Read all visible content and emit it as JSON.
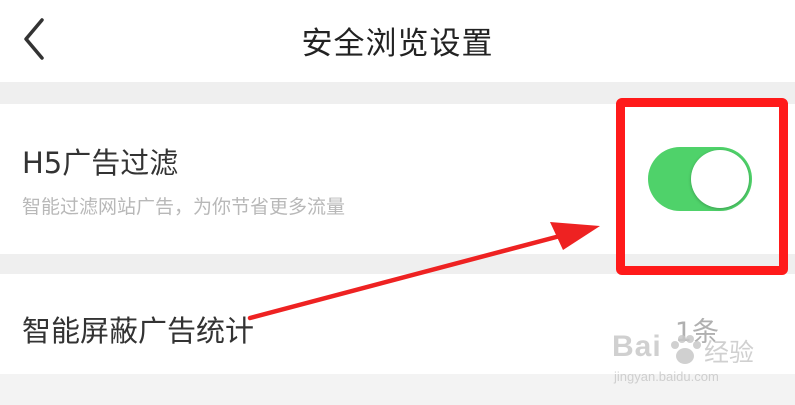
{
  "header": {
    "back_icon": "chevron-left-icon",
    "title": "安全浏览设置"
  },
  "ad_filter": {
    "title": "H5广告过滤",
    "description": "智能过滤网站广告，为你节省更多流量",
    "toggle_on": true,
    "toggle_color": "#4fd26a"
  },
  "ad_stats": {
    "title": "智能屏蔽广告统计",
    "value": "1条"
  },
  "annotation": {
    "highlight_color": "#ff1a1a",
    "arrow_color": "#ee2222"
  },
  "watermark": {
    "brand": "Bai",
    "brand_cn": "经验",
    "url": "jingyan.baidu.com"
  }
}
